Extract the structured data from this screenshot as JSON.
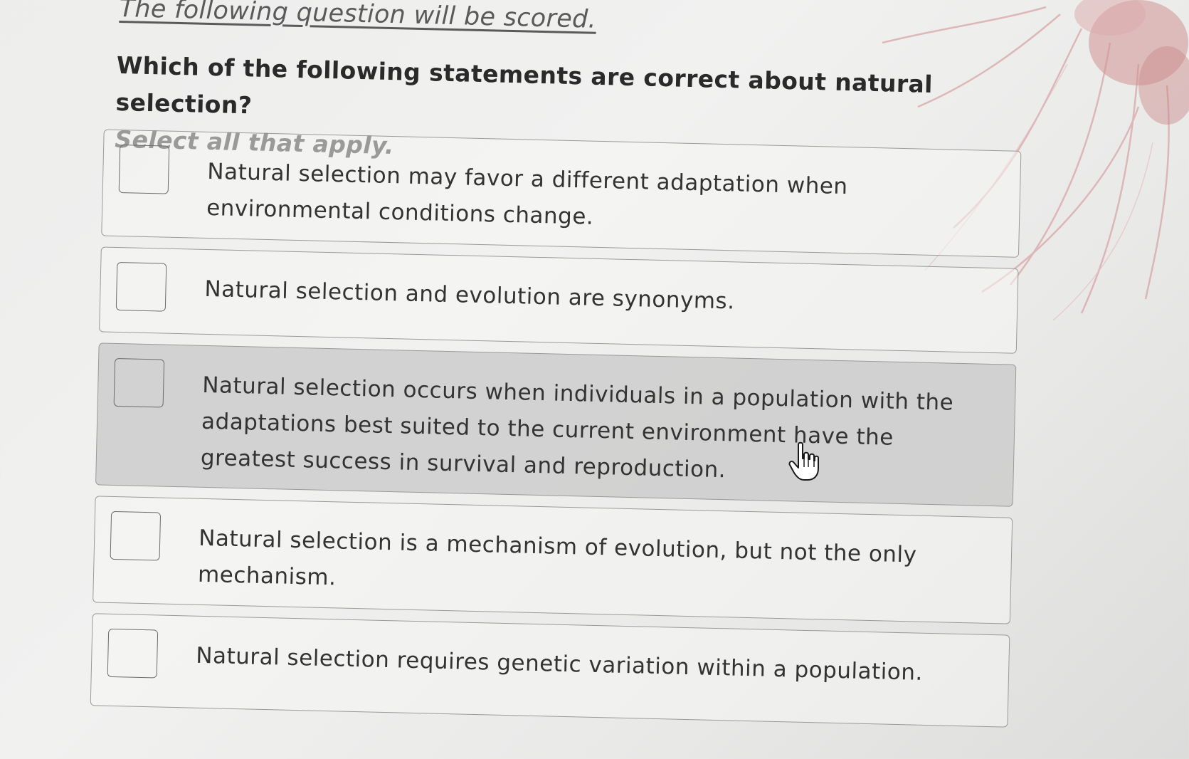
{
  "header": {
    "notice": "The following question will be scored."
  },
  "question": {
    "prompt": "Which of the following statements are correct about natural selection?",
    "instruction": "Select all that apply."
  },
  "options": [
    {
      "label": "Natural selection may favor a different adaptation when environmental conditions change.",
      "checked": false
    },
    {
      "label": "Natural selection and evolution are synonyms.",
      "checked": false
    },
    {
      "label": "Natural selection occurs when individuals in a population with the adaptations best suited to the current environment have the greatest success in survival and reproduction.",
      "checked": false,
      "hovered": true
    },
    {
      "label": "Natural selection is a mechanism of evolution, but not the only mechanism.",
      "checked": false
    },
    {
      "label": "Natural selection requires genetic variation within a population.",
      "checked": false
    }
  ],
  "cursor": {
    "icon": "hand-pointer-icon"
  },
  "colors": {
    "background": "#eeeeed",
    "text": "#333333",
    "border": "#9a9a9a",
    "hover": "#cdcdcc",
    "decoration": "#d9a3a3"
  }
}
